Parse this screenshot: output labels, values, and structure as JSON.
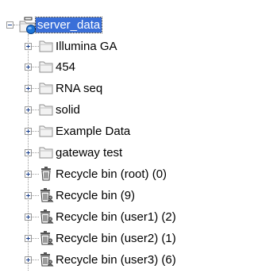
{
  "tree": {
    "root": {
      "label": "server_data",
      "icon": "server-folder-icon",
      "expanded": true,
      "selected": true
    },
    "children": [
      {
        "label": "Illumina GA",
        "icon": "folder-icon"
      },
      {
        "label": "454",
        "icon": "folder-icon"
      },
      {
        "label": "RNA seq",
        "icon": "folder-icon"
      },
      {
        "label": "solid",
        "icon": "folder-icon"
      },
      {
        "label": "Example Data",
        "icon": "folder-icon"
      },
      {
        "label": "gateway test",
        "icon": "folder-icon"
      },
      {
        "label": "Recycle bin (root) (0)",
        "icon": "recycle-bin-icon"
      },
      {
        "label": "Recycle bin (9)",
        "icon": "user-recycle-bin-icon"
      },
      {
        "label": "Recycle bin (user1) (2)",
        "icon": "user-recycle-bin-icon"
      },
      {
        "label": "Recycle bin (user2) (1)",
        "icon": "user-recycle-bin-icon"
      },
      {
        "label": "Recycle bin (user3) (6)",
        "icon": "user-recycle-bin-icon"
      }
    ]
  }
}
